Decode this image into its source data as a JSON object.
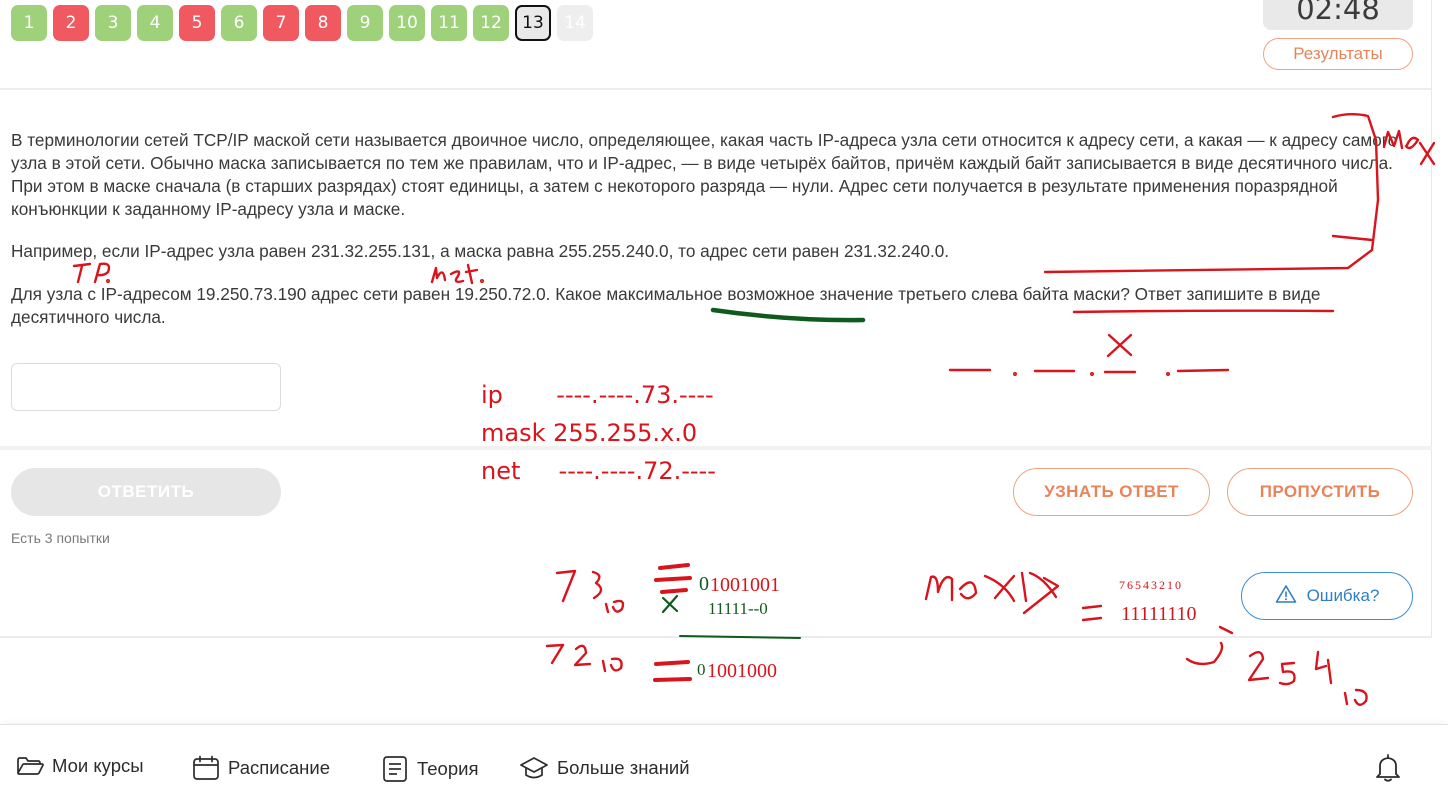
{
  "question_numbers": [
    {
      "label": "1",
      "status": "correct"
    },
    {
      "label": "2",
      "status": "wrong"
    },
    {
      "label": "3",
      "status": "correct"
    },
    {
      "label": "4",
      "status": "correct"
    },
    {
      "label": "5",
      "status": "wrong"
    },
    {
      "label": "6",
      "status": "correct"
    },
    {
      "label": "7",
      "status": "wrong"
    },
    {
      "label": "8",
      "status": "wrong"
    },
    {
      "label": "9",
      "status": "correct"
    },
    {
      "label": "10",
      "status": "correct"
    },
    {
      "label": "11",
      "status": "correct"
    },
    {
      "label": "12",
      "status": "correct"
    },
    {
      "label": "13",
      "status": "current"
    },
    {
      "label": "14",
      "status": "unanswered"
    }
  ],
  "timer": "02:48",
  "results_label": "Результаты",
  "task": {
    "paragraph1": "В терминологии сетей TCP/IP маской сети называется двоичное число, определяющее, какая часть IP-адреса узла сети относится к адресу сети, а какая — к адресу самого узла в этой сети. Обычно маска записывается по тем же правилам, что и IP-адрес, — в виде четырёх байтов, причём каждый байт записывается в виде десятичного числа. При этом в маске сначала (в старших разрядах) стоят единицы, а затем с некоторого разряда — нули. Адрес сети получается в результате применения поразрядной конъюнкции к заданному IP-адресу узла и маске.",
    "paragraph2": "Например, если IP-адрес узла равен 231.32.255.131, а маска равна 255.255.240.0, то адрес сети равен 231.32.240.0.",
    "paragraph3": "Для узла с IP-адресом 19.250.73.190 адрес сети равен 19.250.72.0. Какое максимальное возможное значение третьего слева байта маски? Ответ запишите в виде десятичного числа."
  },
  "answer_input": {
    "value": "",
    "placeholder": ""
  },
  "buttons": {
    "submit": "ОТВЕТИТЬ",
    "reveal": "УЗНАТЬ ОТВЕТ",
    "skip": "ПРОПУСТИТЬ",
    "error": "Ошибка?"
  },
  "attempts_text": "Есть 3 попытки",
  "notes": {
    "ip_line": "ip       ----.----.73.----",
    "mask_line": "mask 255.255.x.0",
    "net_line": "net     ----.----.72.----",
    "bin73": "1001001",
    "bin73_lead": "0",
    "mask_bits": "11111--0",
    "bin72": "1001000",
    "bin72_lead": "0",
    "max_mask_bits": "11111110",
    "bit_positions": "76543210"
  },
  "nav": {
    "courses": "Мои курсы",
    "schedule": "Расписание",
    "theory": "Теория",
    "more": "Больше знаний"
  },
  "colors": {
    "correct": "#9fd17a",
    "wrong": "#f0595f",
    "accent_orange": "#e8835a",
    "accent_blue": "#2f7fc4",
    "annotation_red": "#d8141c",
    "annotation_green": "#0f5a1c"
  }
}
